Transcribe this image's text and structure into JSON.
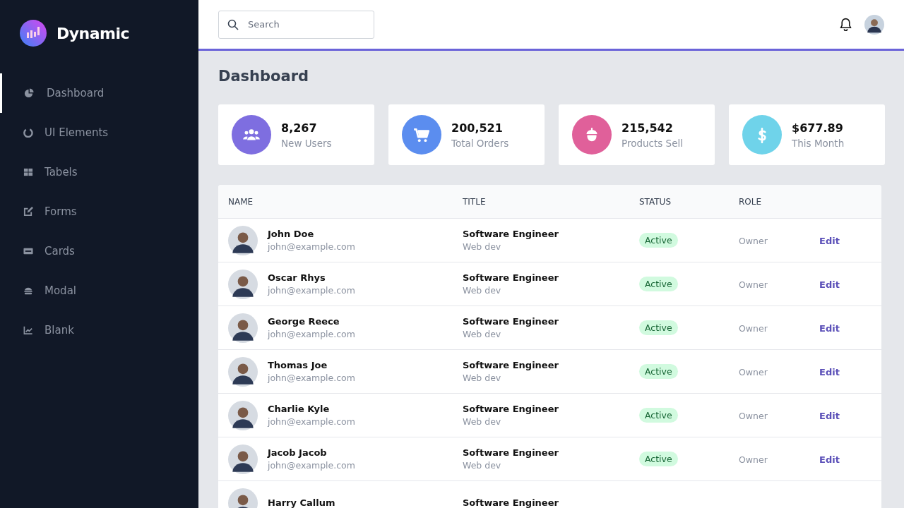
{
  "brand": {
    "name": "Dynamic"
  },
  "sidebar": {
    "items": [
      {
        "label": "Dashboard",
        "kind": "pie",
        "selected": true
      },
      {
        "label": "UI Elements",
        "kind": "ring",
        "selected": false
      },
      {
        "label": "Tabels",
        "kind": "grid",
        "selected": false
      },
      {
        "label": "Forms",
        "kind": "edit",
        "selected": false
      },
      {
        "label": "Cards",
        "kind": "card",
        "selected": false
      },
      {
        "label": "Modal",
        "kind": "burger",
        "selected": false
      },
      {
        "label": "Blank",
        "kind": "chart",
        "selected": false
      }
    ]
  },
  "topbar": {
    "search": {
      "placeholder": "Search"
    }
  },
  "page_title": "Dashboard",
  "stats": [
    {
      "value": "8,267",
      "label": "New Users",
      "kind": "users",
      "color": "#7e6ee0"
    },
    {
      "value": "200,521",
      "label": "Total Orders",
      "kind": "cart",
      "color": "#5b8def"
    },
    {
      "value": "215,542",
      "label": "Products Sell",
      "kind": "acorn",
      "color": "#e0609a"
    },
    {
      "value": "$677.89",
      "label": "This Month",
      "kind": "dollar",
      "color": "#6fd3ea"
    }
  ],
  "table": {
    "columns": [
      "NAME",
      "TITLE",
      "STATUS",
      "ROLE"
    ],
    "rows": [
      {
        "name": "John Doe",
        "email": "john@example.com",
        "title": "Software Engineer",
        "department": "Web dev",
        "status": "Active",
        "role": "Owner",
        "action": "Edit"
      },
      {
        "name": "Oscar Rhys",
        "email": "john@example.com",
        "title": "Software Engineer",
        "department": "Web dev",
        "status": "Active",
        "role": "Owner",
        "action": "Edit"
      },
      {
        "name": "George Reece",
        "email": "john@example.com",
        "title": "Software Engineer",
        "department": "Web dev",
        "status": "Active",
        "role": "Owner",
        "action": "Edit"
      },
      {
        "name": "Thomas Joe",
        "email": "john@example.com",
        "title": "Software Engineer",
        "department": "Web dev",
        "status": "Active",
        "role": "Owner",
        "action": "Edit"
      },
      {
        "name": "Charlie Kyle",
        "email": "john@example.com",
        "title": "Software Engineer",
        "department": "Web dev",
        "status": "Active",
        "role": "Owner",
        "action": "Edit"
      },
      {
        "name": "Jacob Jacob",
        "email": "john@example.com",
        "title": "Software Engineer",
        "department": "Web dev",
        "status": "Active",
        "role": "Owner",
        "action": "Edit"
      },
      {
        "name": "Harry Callum",
        "title": "Software Engineer"
      }
    ]
  }
}
